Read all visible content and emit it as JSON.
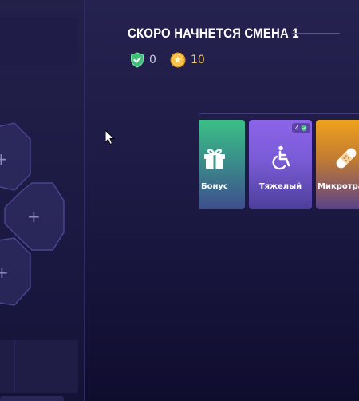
{
  "header": {
    "title": "СКОРО НАЧНЕТСЯ СМЕНА 1"
  },
  "stats": {
    "shield": {
      "value": "0",
      "color": "#4fd08a",
      "icon": "shield-check-icon"
    },
    "coins": {
      "value": "10",
      "color": "#f3b43a",
      "icon": "coin-icon"
    }
  },
  "cards": [
    {
      "label": "Бонус",
      "icon": "gift-icon",
      "accent": "#3bbf86"
    },
    {
      "label": "Тяжелый",
      "icon": "wheelchair-icon",
      "accent": "#8c64e8",
      "badge": "4"
    },
    {
      "label": "Микротра",
      "icon": "bandage-icon",
      "accent": "#f0a21c"
    }
  ]
}
